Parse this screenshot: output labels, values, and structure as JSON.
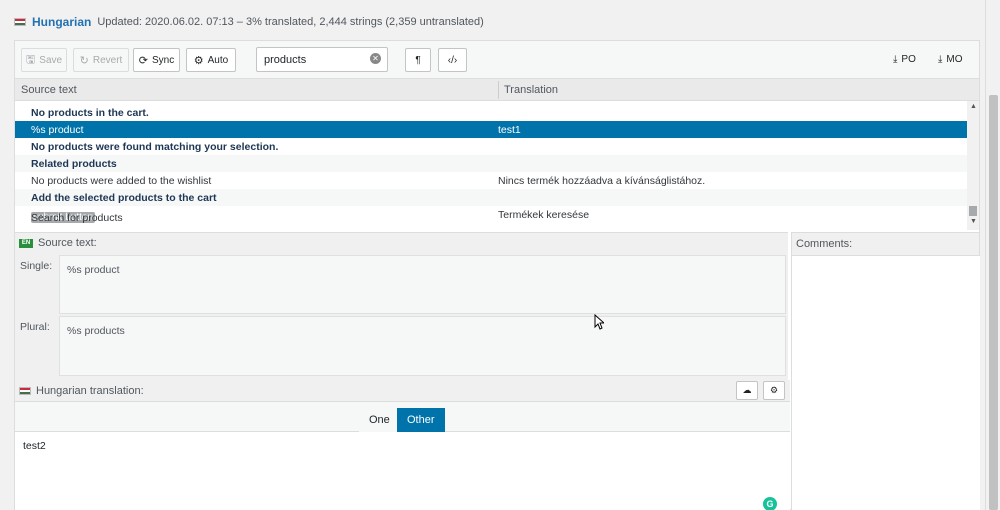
{
  "header": {
    "language": "Hungarian",
    "meta": "Updated: 2020.06.02. 07:13 – 3% translated, 2,444 strings (2,359 untranslated)"
  },
  "toolbar": {
    "save": "Save",
    "revert": "Revert",
    "sync": "Sync",
    "auto": "Auto",
    "search_value": "products",
    "po": "PO",
    "mo": "MO"
  },
  "grid": {
    "col_source": "Source text",
    "col_translation": "Translation",
    "rows": [
      {
        "source": "No products in the cart.",
        "translation": "",
        "bold": true
      },
      {
        "source": "%s product",
        "translation": "test1",
        "bold": false,
        "selected": true
      },
      {
        "source": "No products were found matching your selection.",
        "translation": "",
        "bold": true
      },
      {
        "source": "Related products",
        "translation": "",
        "bold": true
      },
      {
        "source": "No products were added to the wishlist",
        "translation": "Nincs termék hozzáadva a kívánságlistához.",
        "bold": false
      },
      {
        "source": "Add the selected products to the cart",
        "translation": "",
        "bold": true
      },
      {
        "source": "Search for products",
        "tag": "submit button",
        "translation": "Termékek keresése",
        "bold": false
      }
    ]
  },
  "source_panel": {
    "title": "Source text:",
    "badge": "EN",
    "single_label": "Single:",
    "single_value": "%s product",
    "plural_label": "Plural:",
    "plural_value": "%s products"
  },
  "comments": {
    "title": "Comments:"
  },
  "translation_panel": {
    "title": "Hungarian translation:",
    "tab_one": "One",
    "tab_other": "Other",
    "value": "test2"
  },
  "colors": {
    "accent": "#0073aa",
    "link": "#2271b1"
  }
}
